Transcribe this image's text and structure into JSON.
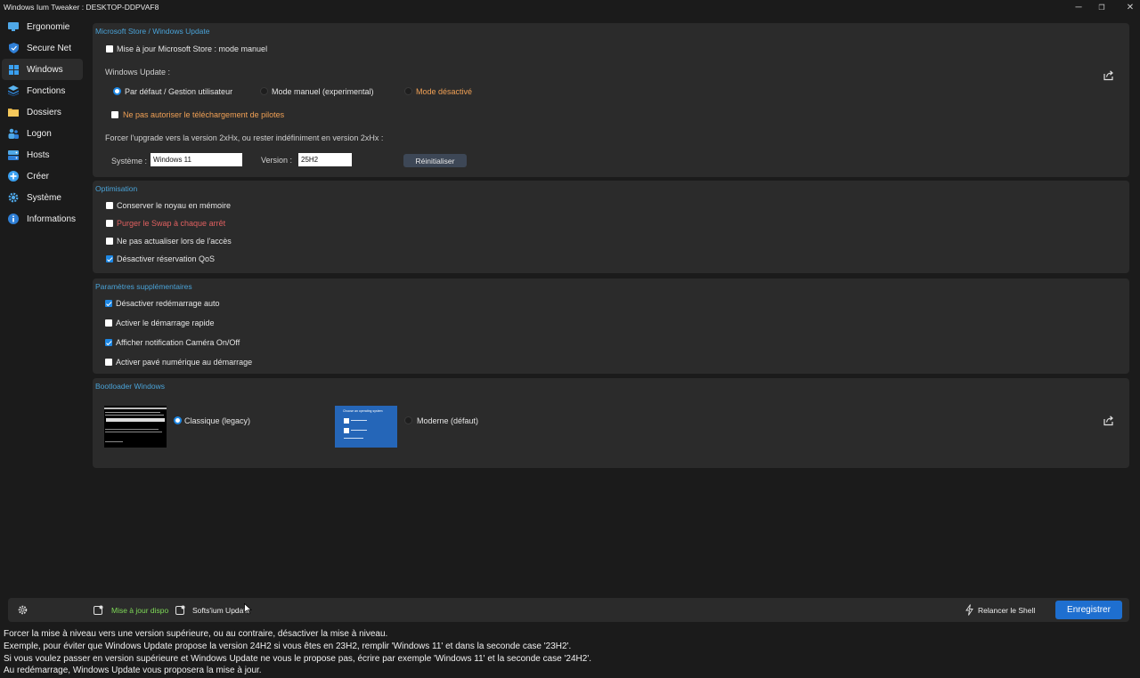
{
  "window": {
    "title": "Windows Ium Tweaker : DESKTOP-DDPVAF8",
    "controls": {
      "minimize": "─",
      "maximize": "❐",
      "close": "✕"
    }
  },
  "sidebar": {
    "items": [
      {
        "label": "Ergonomie",
        "icon": "monitor-icon",
        "active": false
      },
      {
        "label": "Secure Net",
        "icon": "shield-icon",
        "active": false
      },
      {
        "label": "Windows",
        "icon": "windows-logo-icon",
        "active": true
      },
      {
        "label": "Fonctions",
        "icon": "layers-icon",
        "active": false
      },
      {
        "label": "Dossiers",
        "icon": "folder-icon",
        "active": false
      },
      {
        "label": "Logon",
        "icon": "users-icon",
        "active": false
      },
      {
        "label": "Hosts",
        "icon": "server-icon",
        "active": false
      },
      {
        "label": "Créer",
        "icon": "plus-circle-icon",
        "active": false
      },
      {
        "label": "Système",
        "icon": "gear-icon",
        "active": false
      },
      {
        "label": "Informations",
        "icon": "info-icon",
        "active": false
      }
    ]
  },
  "store": {
    "title": "Microsoft Store / Windows Update",
    "manual_label": "Mise à jour Microsoft Store : mode manuel",
    "manual_checked": false,
    "wu_label": "Windows Update :",
    "radio_default": "Par défaut / Gestion utilisateur",
    "radio_manual": "Mode manuel (experimental)",
    "radio_disabled": "Mode désactivé",
    "selected_mode": "default",
    "drivers_label": "Ne pas autoriser le téléchargement de pilotes",
    "drivers_checked": false,
    "force_label": "Forcer l'upgrade vers la version 2xHx, ou rester indéfiniment en version 2xHx :",
    "system_label": "Système :",
    "system_value": "Windows 11",
    "version_label": "Version :",
    "version_value": "25H2",
    "reset_label": "Réinitialiser"
  },
  "optim": {
    "title": "Optimisation",
    "items": [
      {
        "label": "Conserver le noyau en mémoire",
        "checked": false,
        "style": "normal"
      },
      {
        "label": "Purger le Swap à chaque arrêt",
        "checked": false,
        "style": "red"
      },
      {
        "label": "Ne pas actualiser lors de l'accès",
        "checked": false,
        "style": "normal"
      },
      {
        "label": "Désactiver réservation QoS",
        "checked": true,
        "style": "normal"
      }
    ]
  },
  "extra": {
    "title": "Paramètres supplémentaires",
    "items": [
      {
        "label": "Désactiver redémarrage auto",
        "checked": true
      },
      {
        "label": "Activer le démarrage rapide",
        "checked": false
      },
      {
        "label": "Afficher notification Caméra On/Off",
        "checked": true
      },
      {
        "label": "Activer pavé numérique au démarrage",
        "checked": false
      }
    ]
  },
  "boot": {
    "title": "Bootloader Windows",
    "legacy_label": "Classique (legacy)",
    "modern_label": "Moderne (défaut)",
    "modern_thumb_text": "Choose an operating system",
    "selected": "legacy"
  },
  "footer": {
    "update_label": "Mise à jour dispo",
    "softs_label": "Softs'ium Update",
    "shell_label": "Relancer le Shell",
    "save_label": "Enregistrer",
    "accent_green": "#7ed957"
  },
  "help": {
    "lines": [
      "Forcer la mise à niveau vers une version supérieure, ou au contraire, désactiver la mise à niveau.",
      "Exemple, pour éviter que Windows Update propose la version 24H2 si vous êtes en 23H2, remplir 'Windows 11' et dans la seconde case '23H2'.",
      "Si vous voulez passer en version supérieure et Windows Update ne vous le propose pas, écrire par exemple 'Windows 11' et la seconde case '24H2'.",
      "Au redémarrage, Windows Update vous proposera la mise à jour."
    ]
  }
}
